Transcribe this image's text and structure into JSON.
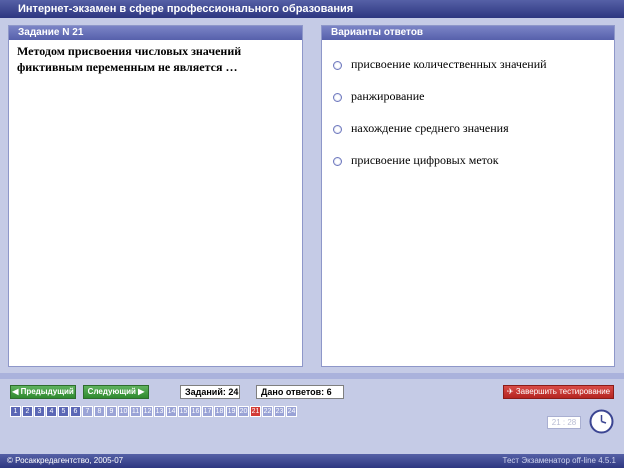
{
  "window": {
    "title": "Интернет-экзамен в сфере профессионального образования"
  },
  "question": {
    "header": "Задание N 21",
    "text_lead": "Методом присвоения числовых значений фиктивным переменным",
    "text_emph": "не является",
    "text_tail": " …"
  },
  "answers": {
    "header": "Варианты ответов",
    "options": [
      "присвоение количественных значений",
      "ранжирование",
      "нахождение среднего значения",
      "присвоение цифровых меток"
    ]
  },
  "nav": {
    "prev_label": "Предыдущий",
    "next_label": "Следующий",
    "tasks_label": "Заданий: 24",
    "answered_label": "Дано ответов: 6",
    "finish_label": "Завершить тестирование"
  },
  "question_numbers": {
    "items": [
      "1",
      "2",
      "3",
      "4",
      "5",
      "6",
      "7",
      "8",
      "9",
      "10",
      "11",
      "12",
      "13",
      "14",
      "15",
      "16",
      "17",
      "18",
      "19",
      "20",
      "21",
      "22",
      "23",
      "24"
    ],
    "answered": [
      "1",
      "2",
      "3",
      "4",
      "5",
      "6"
    ],
    "current": "21"
  },
  "timer": {
    "value": "21 : 28"
  },
  "footer": {
    "copyright": "© Росаккредагентство, 2005-07",
    "version": "Тест Экзаменатор off-line 4.5.1"
  },
  "colors": {
    "accent": "#3b4592",
    "current": "#d23a35",
    "answered": "#5b67b5",
    "pending": "#9aa3d6"
  }
}
